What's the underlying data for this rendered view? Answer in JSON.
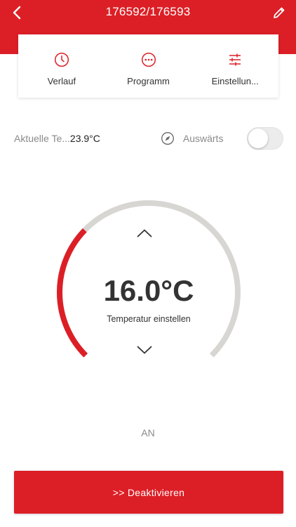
{
  "colors": {
    "accent": "#dc1f26",
    "track": "#d7d6d2",
    "text_dark": "#333333",
    "text_muted": "#8a8a8a"
  },
  "header": {
    "title": "176592/176593",
    "back_icon": "chevron-left-icon",
    "edit_icon": "pencil-icon"
  },
  "menu": {
    "items": [
      {
        "label": "Verlauf",
        "icon": "clock-icon"
      },
      {
        "label": "Programm",
        "icon": "more-horizontal-icon"
      },
      {
        "label": "Einstellun...",
        "icon": "sliders-icon"
      }
    ]
  },
  "status": {
    "current_label": "Aktuelle Te...",
    "current_value": "23.9°C",
    "away_label": "Auswärts",
    "away_icon": "compass-icon",
    "away_enabled": false
  },
  "thermostat": {
    "set_temperature": "16.0°C",
    "caption": "Temperatur einstellen",
    "level_fraction": 0.33,
    "up_icon": "chevron-up-icon",
    "down_icon": "chevron-down-icon"
  },
  "mode": {
    "state": "AN"
  },
  "action": {
    "label": ">>  Deaktivieren"
  }
}
